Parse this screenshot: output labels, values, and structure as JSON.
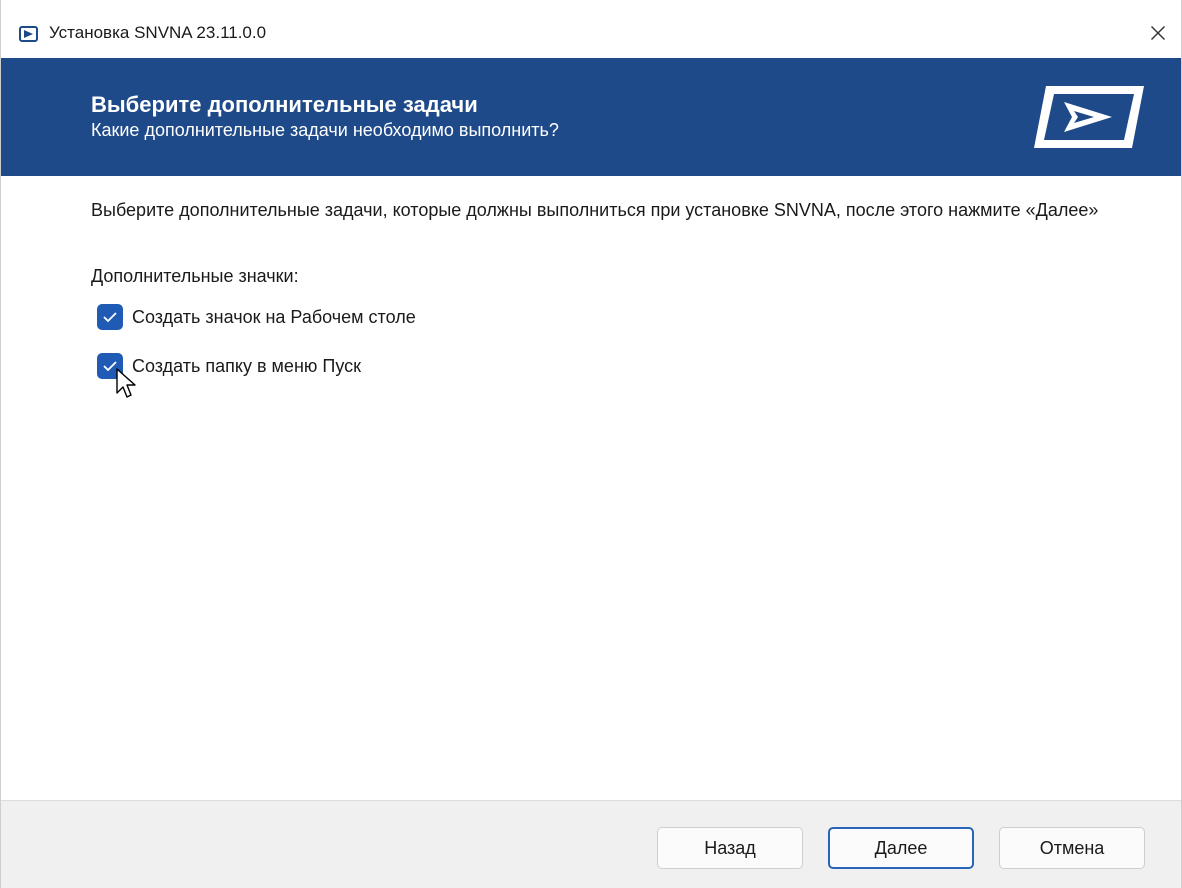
{
  "window": {
    "title": "Установка SNVNA 23.11.0.0"
  },
  "banner": {
    "title": "Выберите дополнительные задачи",
    "subtitle": "Какие дополнительные задачи необходимо выполнить?",
    "logo_icon": "play-arrow-logo-icon"
  },
  "content": {
    "instruction": "Выберите дополнительные задачи, которые должны выполниться при установке SNVNA, после этого нажмите «Далее»",
    "group_label": "Дополнительные значки:",
    "tasks": [
      {
        "label": "Создать значок на Рабочем столе",
        "checked": true
      },
      {
        "label": "Создать папку в меню Пуск",
        "checked": true
      }
    ]
  },
  "footer": {
    "back_label": "Назад",
    "next_label": "Далее",
    "cancel_label": "Отмена"
  },
  "colors": {
    "banner": "#1f4a8a",
    "checkbox": "#1f5bb5",
    "focus_border": "#2a64b8",
    "footer": "#f0f0f0"
  }
}
